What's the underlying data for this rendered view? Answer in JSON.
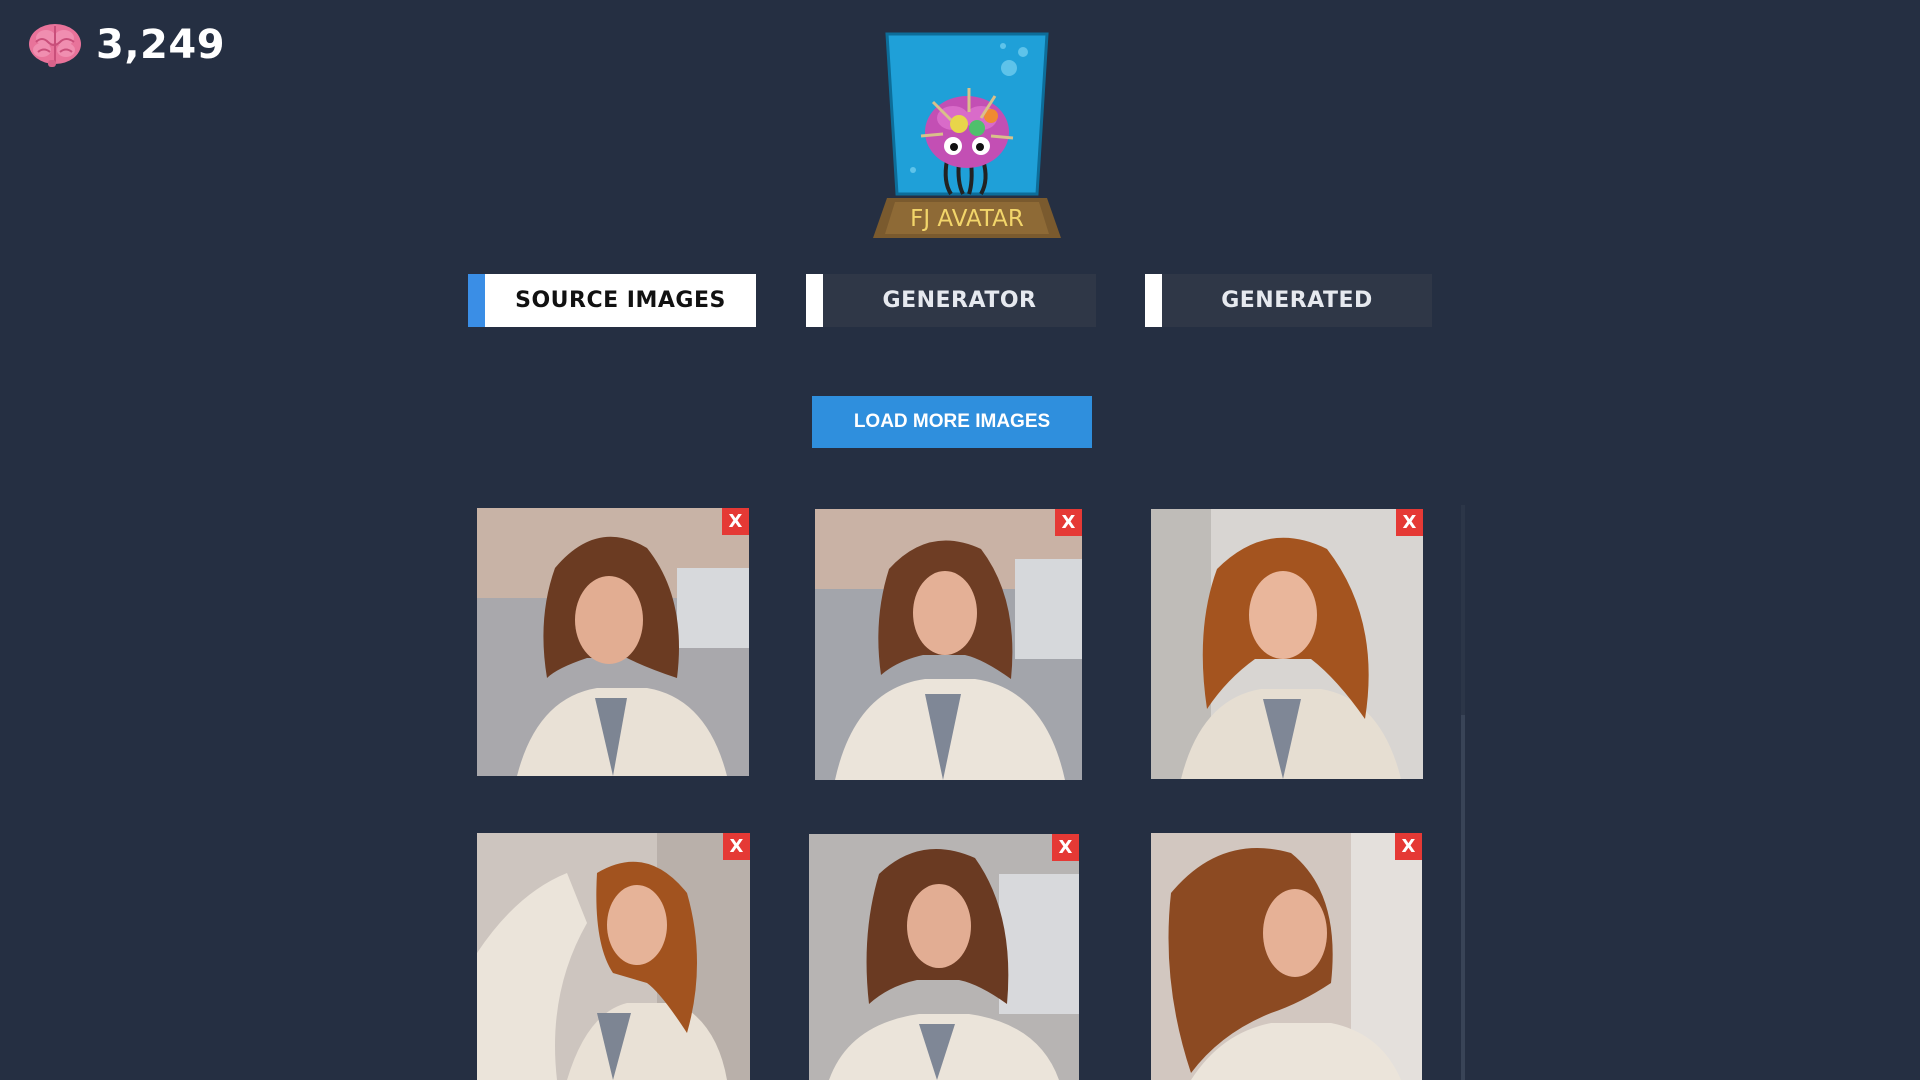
{
  "score": {
    "value": "3,249",
    "icon": "brain-icon"
  },
  "logo": {
    "text": "FJ AVATAR"
  },
  "tabs": [
    {
      "label": "SOURCE IMAGES",
      "active": true
    },
    {
      "label": "GENERATOR",
      "active": false
    },
    {
      "label": "GENERATED",
      "active": false
    }
  ],
  "load_more": {
    "label": "LOAD MORE IMAGES"
  },
  "images": [
    {
      "remove_label": "X"
    },
    {
      "remove_label": "X"
    },
    {
      "remove_label": "X"
    },
    {
      "remove_label": "X"
    },
    {
      "remove_label": "X"
    },
    {
      "remove_label": "X"
    }
  ],
  "colors": {
    "background": "#252f42",
    "accent": "#3a8ee6",
    "button": "#2f8fdd",
    "remove": "#e53935",
    "tab_inactive": "#2f3747"
  }
}
